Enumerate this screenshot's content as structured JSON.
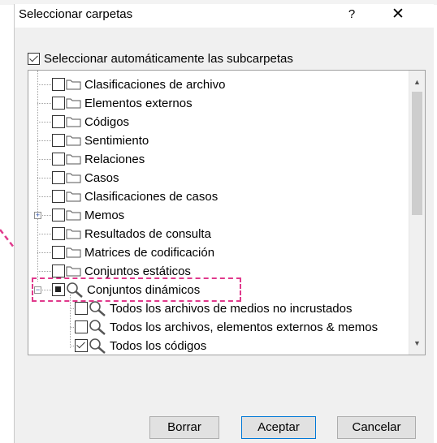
{
  "dialog": {
    "title": "Seleccionar carpetas",
    "help_label": "?",
    "close_label": "✕"
  },
  "auto_select": {
    "label": "Seleccionar automáticamente las subcarpetas",
    "checked": true
  },
  "tree": {
    "items": [
      {
        "label": "Clasificaciones de archivo",
        "icon": "folder-icon",
        "checked": false
      },
      {
        "label": "Elementos externos",
        "icon": "folder-icon",
        "checked": false
      },
      {
        "label": "Códigos",
        "icon": "folder-icon",
        "checked": false
      },
      {
        "label": "Sentimiento",
        "icon": "folder-icon",
        "checked": false
      },
      {
        "label": "Relaciones",
        "icon": "folder-icon",
        "checked": false
      },
      {
        "label": "Casos",
        "icon": "folder-icon",
        "checked": false
      },
      {
        "label": "Clasificaciones de casos",
        "icon": "folder-icon",
        "checked": false
      },
      {
        "label": "Memos",
        "icon": "folder-icon",
        "checked": false,
        "expander": "+"
      },
      {
        "label": "Resultados de consulta",
        "icon": "folder-icon",
        "checked": false
      },
      {
        "label": "Matrices de codificación",
        "icon": "folder-icon",
        "checked": false
      },
      {
        "label": "Conjuntos estáticos",
        "icon": "folder-icon",
        "checked": false
      },
      {
        "label": "Conjuntos dinámicos",
        "icon": "search-icon",
        "checked": "partial",
        "expander": "−"
      },
      {
        "label": "Todos los archivos de medios no incrustados",
        "icon": "search-icon",
        "checked": false
      },
      {
        "label": "Todos los archivos, elementos externos & memos",
        "icon": "search-icon",
        "checked": false
      },
      {
        "label": "Todos los códigos",
        "icon": "search-icon",
        "checked": true
      }
    ]
  },
  "buttons": {
    "clear": "Borrar",
    "accept": "Aceptar",
    "cancel": "Cancelar"
  },
  "colors": {
    "highlight": "#e0398c",
    "accent": "#0078d7"
  }
}
